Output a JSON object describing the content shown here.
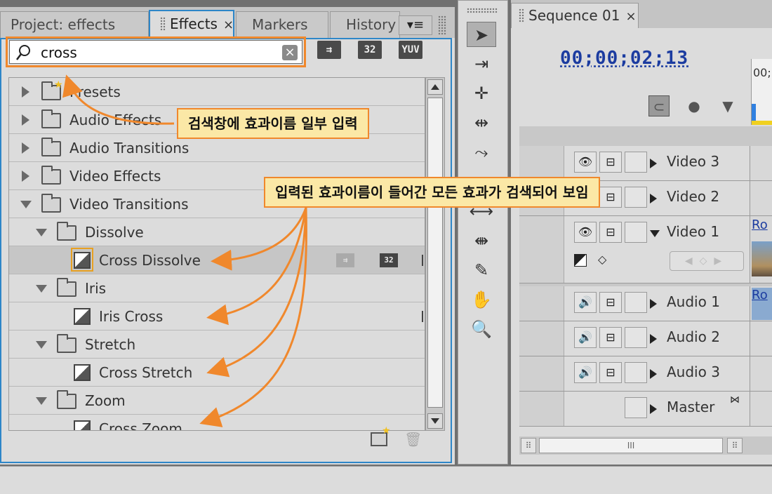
{
  "effects_panel": {
    "tabs": [
      {
        "label": "Project: effects"
      },
      {
        "label": "Effects",
        "close": "×"
      },
      {
        "label": "Markers"
      },
      {
        "label": "History"
      }
    ],
    "panel_menu_icon": "≡",
    "search": {
      "value": "cross",
      "clear_icon": "×"
    },
    "toolbar_buttons": [
      {
        "label": "⇉"
      },
      {
        "label": "32"
      },
      {
        "label": "YUV"
      }
    ],
    "tree": [
      {
        "label": "Presets",
        "kind": "folder",
        "expanded": false,
        "depth": 0
      },
      {
        "label": "Audio Effects",
        "kind": "folder",
        "expanded": false,
        "depth": 0
      },
      {
        "label": "Audio Transitions",
        "kind": "folder",
        "expanded": false,
        "depth": 0
      },
      {
        "label": "Video Effects",
        "kind": "folder",
        "expanded": false,
        "depth": 0
      },
      {
        "label": "Video Transitions",
        "kind": "folder",
        "expanded": true,
        "depth": 0
      },
      {
        "label": "Dissolve",
        "kind": "folder",
        "expanded": true,
        "depth": 1
      },
      {
        "label": "Cross Dissolve",
        "kind": "item",
        "selected": true,
        "badge_a": "⇉",
        "badge_b": "32",
        "depth": 2
      },
      {
        "label": "Iris",
        "kind": "folder",
        "expanded": true,
        "depth": 1
      },
      {
        "label": "Iris Cross",
        "kind": "item",
        "depth": 2
      },
      {
        "label": "Stretch",
        "kind": "folder",
        "expanded": true,
        "depth": 1
      },
      {
        "label": "Cross Stretch",
        "kind": "item",
        "depth": 2
      },
      {
        "label": "Zoom",
        "kind": "folder",
        "expanded": true,
        "depth": 1
      },
      {
        "label": "Cross Zoom",
        "kind": "item",
        "depth": 2
      }
    ],
    "bottom_icons": {
      "new_bin": "★",
      "trash": "🗑"
    }
  },
  "tools": [
    "➤",
    "⇥",
    "✛",
    "⇹",
    "⤳",
    "⟷",
    "⇼",
    "✎",
    "✋",
    "🔍"
  ],
  "sequence_panel": {
    "tab_label": "Sequence 01",
    "tab_close": "×",
    "timecode": "00;00;02;13",
    "ruler_label": "00;",
    "tracks": [
      {
        "name": "Video 3",
        "kind": "video",
        "expanded": false,
        "clip": ""
      },
      {
        "name": "Video 2",
        "kind": "video",
        "expanded": false,
        "clip": ""
      },
      {
        "name": "Video 1",
        "kind": "video",
        "expanded": true,
        "clip": "Ro"
      },
      {
        "name": "Audio 1",
        "kind": "audio",
        "expanded": false,
        "clip": "Ro"
      },
      {
        "name": "Audio 2",
        "kind": "audio",
        "expanded": false,
        "clip": ""
      },
      {
        "name": "Audio 3",
        "kind": "audio",
        "expanded": false,
        "clip": ""
      },
      {
        "name": "Master",
        "kind": "master",
        "expanded": false,
        "clip": ""
      }
    ],
    "hscroll_mark": "III"
  },
  "callouts": {
    "search_note": "검색창에 효과이름 일부 입력",
    "result_note": "입력된 효과이름이 들어간 모든 효과가 검색되어 보임"
  },
  "colors": {
    "accent": "#2d86c8",
    "callout_border": "#f0882c",
    "callout_fill": "#fbe8a6",
    "timecode": "#1c3ca0"
  }
}
